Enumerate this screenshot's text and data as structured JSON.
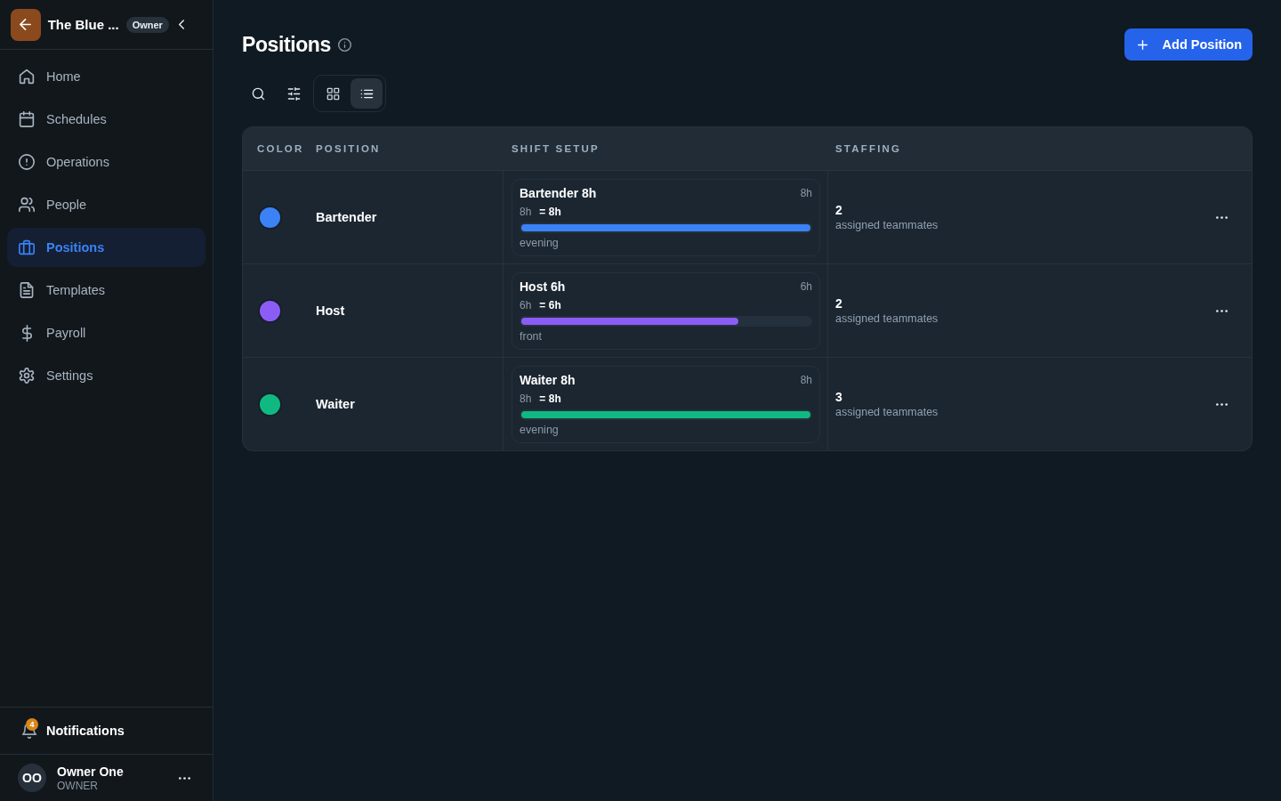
{
  "sidebar": {
    "workspace": {
      "name": "The Blue ...",
      "badge": "Owner"
    },
    "nav": [
      {
        "label": "Home",
        "selected": false
      },
      {
        "label": "Schedules",
        "selected": false
      },
      {
        "label": "Operations",
        "selected": false
      },
      {
        "label": "People",
        "selected": false
      },
      {
        "label": "Positions",
        "selected": true
      },
      {
        "label": "Templates",
        "selected": false
      },
      {
        "label": "Payroll",
        "selected": false
      },
      {
        "label": "Settings",
        "selected": false
      }
    ],
    "notifications": {
      "label": "Notifications",
      "count": "4"
    },
    "user": {
      "initials": "OO",
      "name": "Owner One",
      "role": "OWNER"
    }
  },
  "header": {
    "title": "Positions",
    "add_button": "Add Position"
  },
  "toolbar": {
    "views": [
      {
        "kind": "grid",
        "selected": false
      },
      {
        "kind": "list",
        "selected": true
      }
    ]
  },
  "table": {
    "columns": [
      "COLOR",
      "POSITION",
      "SHIFT SETUP",
      "STAFFING"
    ],
    "rows": [
      {
        "color": "#3b82f6",
        "name": "Bartender",
        "shift": {
          "title": "Bartender 8h",
          "duration": "8h",
          "breakdown": "8h",
          "total": "= 8h",
          "level": 1,
          "tag": "evening"
        },
        "staffing": {
          "count": "2",
          "label": "assigned teammates"
        }
      },
      {
        "color": "#8b5cf6",
        "name": "Host",
        "shift": {
          "title": "Host 6h",
          "duration": "6h",
          "breakdown": "6h",
          "total": "= 6h",
          "level": 0.75,
          "tag": "front"
        },
        "staffing": {
          "count": "2",
          "label": "assigned teammates"
        }
      },
      {
        "color": "#10b981",
        "name": "Waiter",
        "shift": {
          "title": "Waiter 8h",
          "duration": "8h",
          "breakdown": "8h",
          "total": "= 8h",
          "level": 1,
          "tag": "evening"
        },
        "staffing": {
          "count": "3",
          "label": "assigned teammates"
        }
      }
    ]
  }
}
